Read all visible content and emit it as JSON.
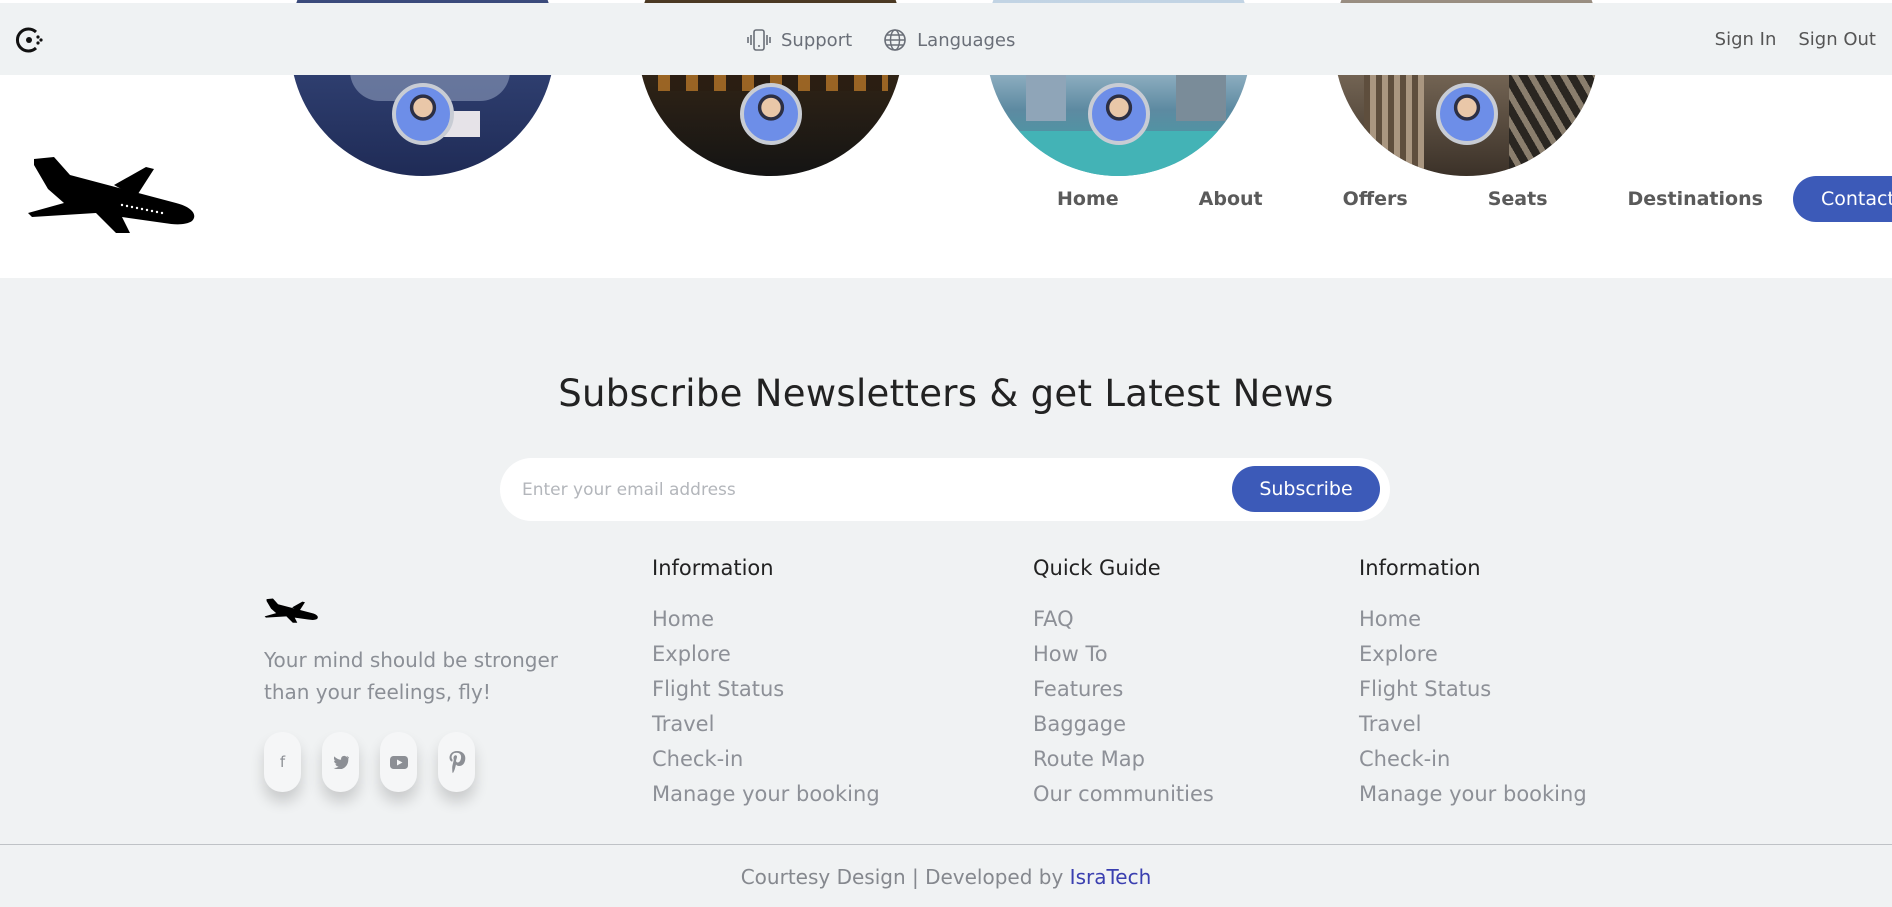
{
  "topbar": {
    "support": "Support",
    "languages": "Languages",
    "sign_in": "Sign In",
    "sign_out": "Sign Out"
  },
  "nav": {
    "items": [
      "Home",
      "About",
      "Offers",
      "Seats",
      "Destinations"
    ],
    "contact": "Contact"
  },
  "newsletter": {
    "title": "Subscribe Newsletters & get Latest News",
    "placeholder": "Enter your email address",
    "button": "Subscribe"
  },
  "brand": {
    "tagline": "Your mind should be stronger than your feelings, fly!"
  },
  "socials": [
    "facebook-icon",
    "twitter-icon",
    "youtube-icon",
    "pinterest-icon"
  ],
  "columns": [
    {
      "title": "Information",
      "items": [
        "Home",
        "Explore",
        "Flight Status",
        "Travel",
        "Check-in",
        "Manage your booking"
      ]
    },
    {
      "title": "Quick Guide",
      "items": [
        "FAQ",
        "How To",
        "Features",
        "Baggage",
        "Route Map",
        "Our communities"
      ]
    },
    {
      "title": "Information",
      "items": [
        "Home",
        "Explore",
        "Flight Status",
        "Travel",
        "Check-in",
        "Manage your booking"
      ]
    }
  ],
  "footer": {
    "copyright_prefix": "Courtesy Design | Developed by ",
    "developer": "IsraTech"
  },
  "colors": {
    "accent": "#3c5ab8",
    "link": "#3a3fb0",
    "footer_bg": "#f0f2f3"
  }
}
